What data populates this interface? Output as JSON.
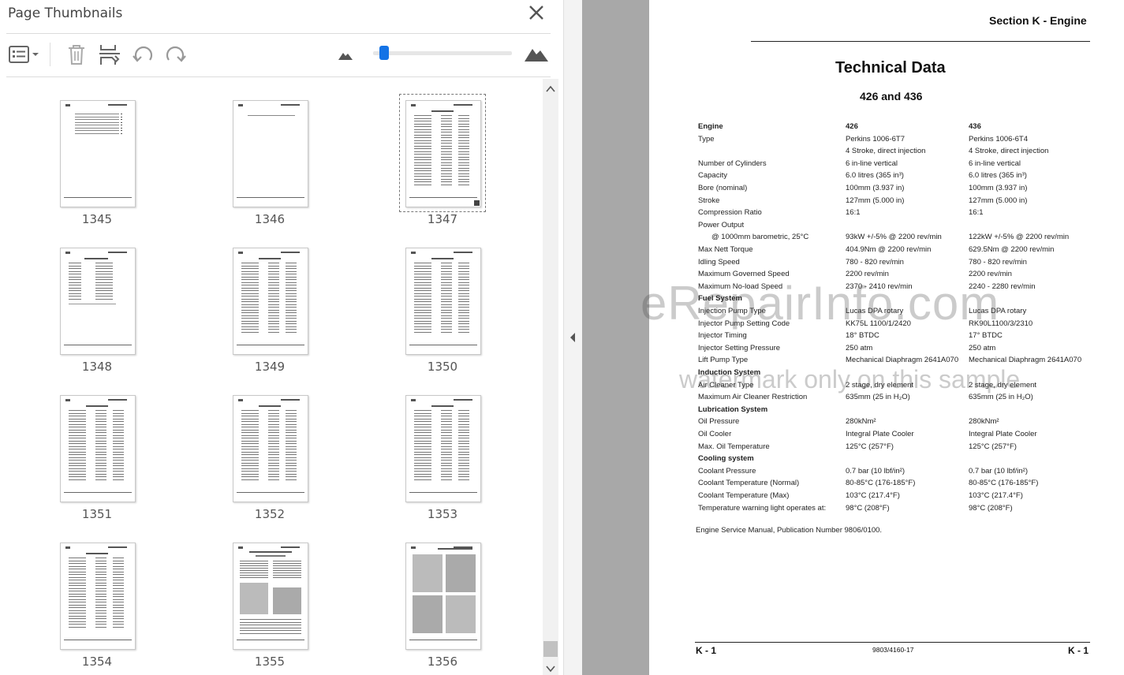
{
  "panel": {
    "title": "Page Thumbnails",
    "close_icon": "close-icon",
    "toolbar": {
      "options_icon": "thumbnail-options-icon",
      "delete_icon": "trash-icon",
      "insert_icon": "insert-pages-icon",
      "rotate_ccw_icon": "rotate-counterclockwise-icon",
      "rotate_cw_icon": "rotate-clockwise-icon",
      "zoom_out_icon": "mountain-small-icon",
      "zoom_in_icon": "mountain-large-icon",
      "zoom_level": 0.05
    },
    "thumbnails": [
      {
        "page": "1345",
        "kind": "toc"
      },
      {
        "page": "1346",
        "kind": "blank"
      },
      {
        "page": "1347",
        "kind": "table",
        "selected": true
      },
      {
        "page": "1348",
        "kind": "short"
      },
      {
        "page": "1349",
        "kind": "table"
      },
      {
        "page": "1350",
        "kind": "table"
      },
      {
        "page": "1351",
        "kind": "table"
      },
      {
        "page": "1352",
        "kind": "table"
      },
      {
        "page": "1353",
        "kind": "table"
      },
      {
        "page": "1354",
        "kind": "table"
      },
      {
        "page": "1355",
        "kind": "figure"
      },
      {
        "page": "1356",
        "kind": "figures"
      }
    ]
  },
  "document": {
    "section_title": "Section K - Engine",
    "heading": "Technical Data",
    "subheading": "426 and 436",
    "rows": [
      {
        "label": "Engine",
        "a": "426",
        "b": "436",
        "bold": true
      },
      {
        "label": "Type",
        "a": "Perkins 1006-6T7",
        "b": "Perkins 1006-6T4"
      },
      {
        "label": "",
        "a": "4 Stroke, direct injection",
        "b": "4 Stroke, direct injection"
      },
      {
        "label": "Number of Cylinders",
        "a": "6 in-line vertical",
        "b": "6 in-line vertical"
      },
      {
        "label": "Capacity",
        "a": "6.0 litres (365 in³)",
        "b": "6.0 litres (365 in³)"
      },
      {
        "label": "Bore (nominal)",
        "a": "100mm (3.937 in)",
        "b": "100mm (3.937 in)"
      },
      {
        "label": "Stroke",
        "a": "127mm (5.000 in)",
        "b": "127mm (5.000 in)"
      },
      {
        "label": "Compression Ratio",
        "a": "16:1",
        "b": "16:1"
      },
      {
        "label": "Power Output",
        "a": "",
        "b": ""
      },
      {
        "label": "@ 1000mm barometric, 25°C",
        "a": "93kW +/-5% @ 2200 rev/min",
        "b": "122kW +/-5% @ 2200 rev/min",
        "indent": true
      },
      {
        "label": "Max Nett Torque",
        "a": "404.9Nm @ 2200 rev/min",
        "b": "629.5Nm @ 2200 rev/min"
      },
      {
        "label": "Idling Speed",
        "a": "780 - 820 rev/min",
        "b": "780 - 820 rev/min"
      },
      {
        "label": "Maximum Governed Speed",
        "a": "2200 rev/min",
        "b": "2200 rev/min"
      },
      {
        "label": "Maximum No-load Speed",
        "a": "2370 - 2410 rev/min",
        "b": "2240 - 2280 rev/min"
      },
      {
        "label": "Fuel System",
        "a": "",
        "b": "",
        "bold": true
      },
      {
        "label": "Injection Pump Type",
        "a": "Lucas DPA rotary",
        "b": "Lucas DPA rotary"
      },
      {
        "label": "Injector Pump Setting Code",
        "a": "KK75L 1100/1/2420",
        "b": "RK90L1100/3/2310"
      },
      {
        "label": "Injector Timing",
        "a": "18° BTDC",
        "b": "17° BTDC"
      },
      {
        "label": "Injector Setting Pressure",
        "a": "250 atm",
        "b": "250 atm"
      },
      {
        "label": "Lift Pump Type",
        "a": "Mechanical Diaphragm 2641A070",
        "b": "Mechanical Diaphragm 2641A070"
      },
      {
        "label": "Induction System",
        "a": "",
        "b": "",
        "bold": true
      },
      {
        "label": "Air Cleaner Type",
        "a": "2 stage, dry element",
        "b": "2 stage, dry element"
      },
      {
        "label": "Maximum Air Cleaner Restriction",
        "a": "635mm (25 in H₂O)",
        "b": "635mm (25 in H₂O)"
      },
      {
        "label": "Lubrication System",
        "a": "",
        "b": "",
        "bold": true
      },
      {
        "label": "Oil Pressure",
        "a": "280kNm²",
        "b": "280kNm²"
      },
      {
        "label": "Oil Cooler",
        "a": "Integral Plate Cooler",
        "b": "Integral Plate Cooler"
      },
      {
        "label": "Max. Oil Temperature",
        "a": "125°C (257°F)",
        "b": "125°C (257°F)"
      },
      {
        "label": "Cooling system",
        "a": "",
        "b": "",
        "bold": true
      },
      {
        "label": "Coolant Pressure",
        "a": "0.7 bar (10 lbf/in²)",
        "b": "0.7 bar (10 lbf/in²)"
      },
      {
        "label": "Coolant Temperature (Normal)",
        "a": "80-85°C (176-185°F)",
        "b": "80-85°C (176-185°F)"
      },
      {
        "label": "Coolant Temperature (Max)",
        "a": "103°C (217.4°F)",
        "b": "103°C (217.4°F)"
      },
      {
        "label": "Temperature warning light operates at:",
        "a": "98°C (208°F)",
        "b": "98°C (208°F)"
      }
    ],
    "manual_note": "Engine Service Manual, Publication Number 9806/0100.",
    "footer_left": "K - 1",
    "footer_center": "9803/4160-17",
    "footer_right": "K - 1",
    "watermark_main": "eRepairInfo.com",
    "watermark_sub": "watermark only on this sample"
  },
  "colors": {
    "accent": "#1473e6",
    "viewer_background": "#a8a8a8"
  }
}
